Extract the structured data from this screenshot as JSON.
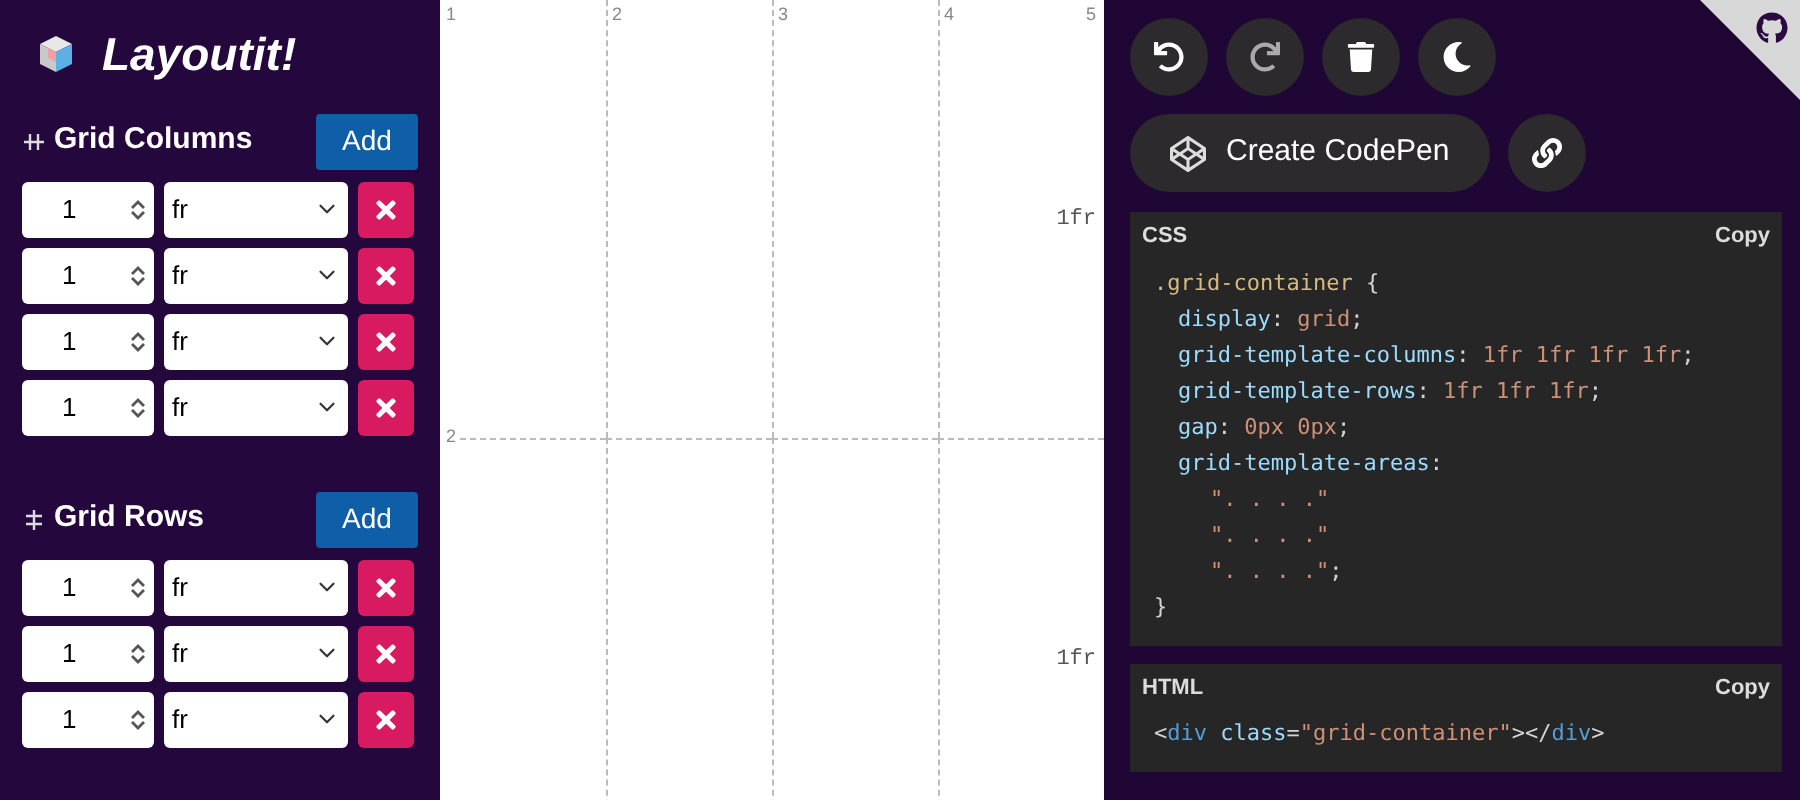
{
  "app": {
    "title": "Layoutit!"
  },
  "sections": [
    {
      "title": "Grid Columns",
      "kind": "columns",
      "add_label": "Add",
      "tracks": [
        {
          "value": "1",
          "unit": "fr"
        },
        {
          "value": "1",
          "unit": "fr"
        },
        {
          "value": "1",
          "unit": "fr"
        },
        {
          "value": "1",
          "unit": "fr"
        }
      ]
    },
    {
      "title": "Grid Rows",
      "kind": "rows",
      "add_label": "Add",
      "tracks": [
        {
          "value": "1",
          "unit": "fr"
        },
        {
          "value": "1",
          "unit": "fr"
        },
        {
          "value": "1",
          "unit": "fr"
        }
      ]
    }
  ],
  "canvas": {
    "column_lines": [
      "1",
      "2",
      "3",
      "4",
      "5"
    ],
    "row_lines": [
      "2"
    ],
    "row_sizes": [
      "1fr",
      "1fr"
    ]
  },
  "toolbar": {
    "codepen_label": "Create CodePen"
  },
  "code_panels": [
    {
      "title": "CSS",
      "copy_label": "Copy",
      "lines": [
        {
          "kind": "open",
          "tokens": [
            {
              "kind": "selector",
              "text": ".grid-container"
            },
            {
              "kind": "punct",
              "text": " {"
            }
          ]
        },
        {
          "kind": "decl",
          "tokens": [
            {
              "kind": "prop",
              "text": "display"
            },
            {
              "kind": "punct",
              "text": ": "
            },
            {
              "kind": "value",
              "text": "grid"
            },
            {
              "kind": "punct",
              "text": ";"
            }
          ]
        },
        {
          "kind": "decl",
          "tokens": [
            {
              "kind": "prop",
              "text": "grid-template-columns"
            },
            {
              "kind": "punct",
              "text": ": "
            },
            {
              "kind": "value",
              "text": "1fr 1fr 1fr 1fr"
            },
            {
              "kind": "punct",
              "text": ";"
            }
          ]
        },
        {
          "kind": "decl",
          "tokens": [
            {
              "kind": "prop",
              "text": "grid-template-rows"
            },
            {
              "kind": "punct",
              "text": ": "
            },
            {
              "kind": "value",
              "text": "1fr 1fr 1fr"
            },
            {
              "kind": "punct",
              "text": ";"
            }
          ]
        },
        {
          "kind": "decl",
          "tokens": [
            {
              "kind": "prop",
              "text": "gap"
            },
            {
              "kind": "punct",
              "text": ": "
            },
            {
              "kind": "value",
              "text": "0px 0px"
            },
            {
              "kind": "punct",
              "text": ";"
            }
          ]
        },
        {
          "kind": "decl",
          "tokens": [
            {
              "kind": "prop",
              "text": "grid-template-areas"
            },
            {
              "kind": "punct",
              "text": ":"
            }
          ]
        },
        {
          "kind": "area",
          "tokens": [
            {
              "kind": "string",
              "text": "\". . . .\""
            }
          ]
        },
        {
          "kind": "area",
          "tokens": [
            {
              "kind": "string",
              "text": "\". . . .\""
            }
          ]
        },
        {
          "kind": "area",
          "tokens": [
            {
              "kind": "string",
              "text": "\". . . .\""
            },
            {
              "kind": "punct",
              "text": ";"
            }
          ]
        },
        {
          "kind": "close",
          "tokens": [
            {
              "kind": "punct",
              "text": "}"
            }
          ]
        }
      ]
    },
    {
      "title": "HTML",
      "copy_label": "Copy",
      "lines": [
        {
          "kind": "open",
          "tokens": [
            {
              "kind": "punct",
              "text": "<"
            },
            {
              "kind": "tag",
              "text": "div"
            },
            {
              "kind": "attr",
              "text": " class"
            },
            {
              "kind": "punct",
              "text": "="
            },
            {
              "kind": "value",
              "text": "\"grid-container\""
            },
            {
              "kind": "punct",
              "text": "></"
            },
            {
              "kind": "tag",
              "text": "div"
            },
            {
              "kind": "punct",
              "text": ">"
            }
          ]
        }
      ]
    }
  ]
}
